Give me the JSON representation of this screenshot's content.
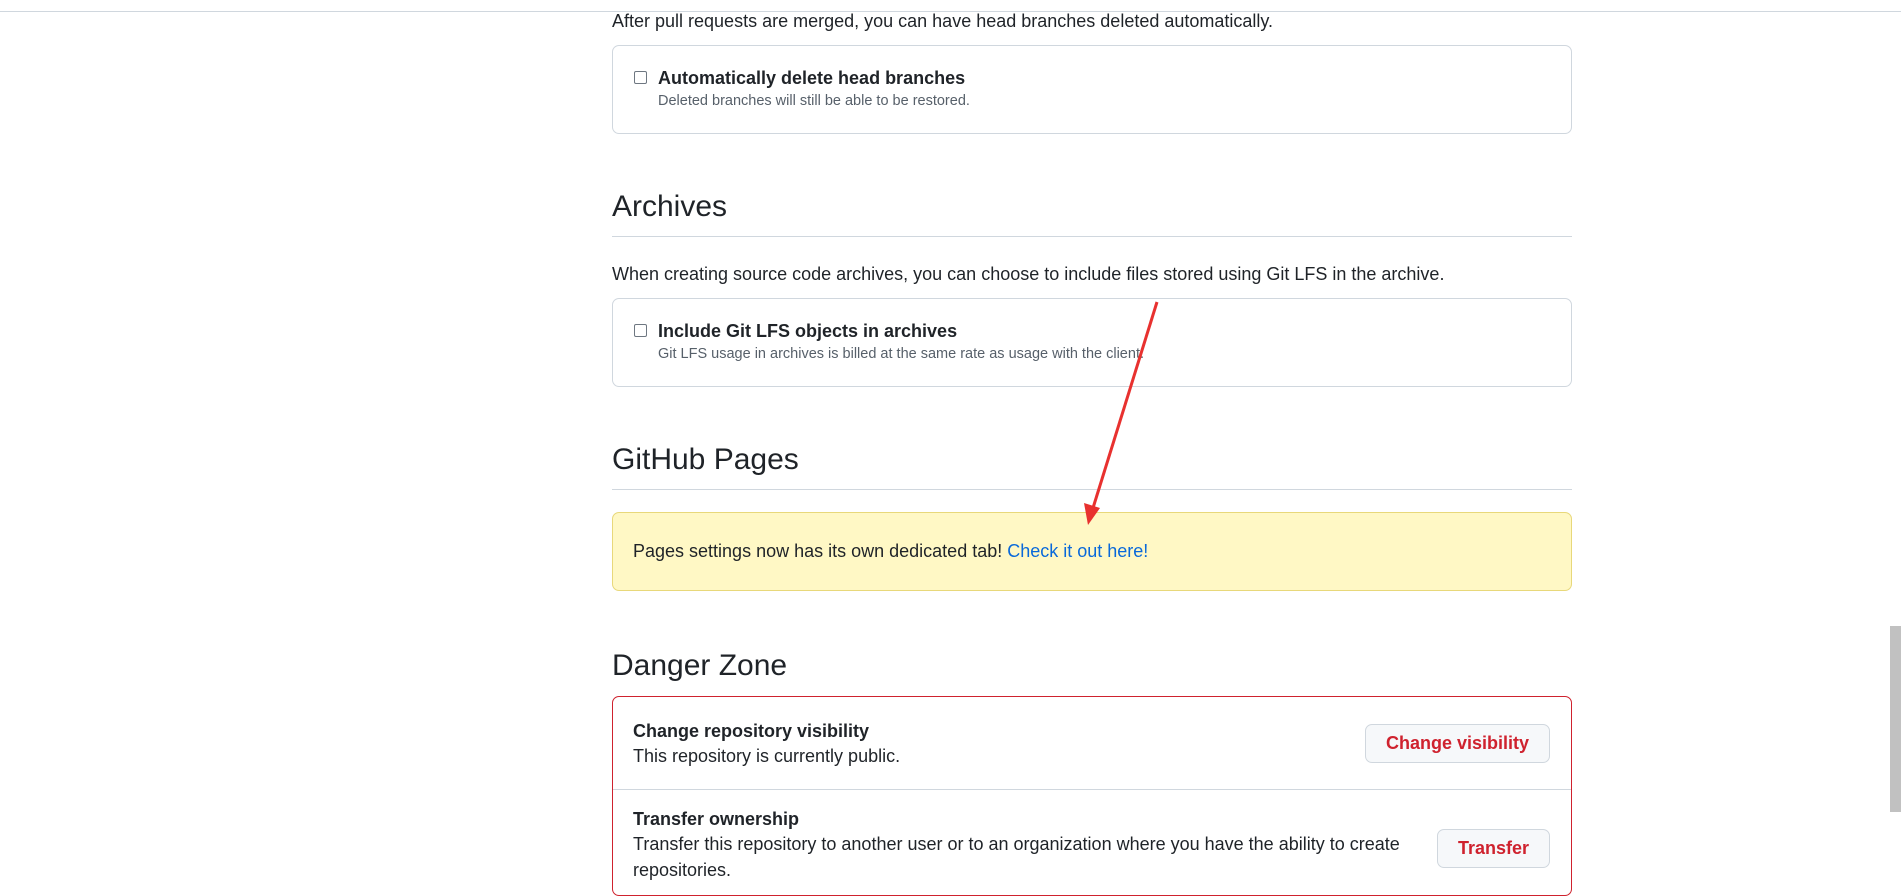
{
  "merge": {
    "description": "After pull requests are merged, you can have head branches deleted automatically.",
    "option_title": "Automatically delete head branches",
    "option_note": "Deleted branches will still be able to be restored."
  },
  "archives": {
    "heading": "Archives",
    "description": "When creating source code archives, you can choose to include files stored using Git LFS in the archive.",
    "option_title": "Include Git LFS objects in archives",
    "option_note": "Git LFS usage in archives is billed at the same rate as usage with the client."
  },
  "pages": {
    "heading": "GitHub Pages",
    "flash_text": "Pages settings now has its own dedicated tab!",
    "flash_link": "Check it out here!"
  },
  "danger": {
    "heading": "Danger Zone",
    "items": [
      {
        "title": "Change repository visibility",
        "text": "This repository is currently public.",
        "button": "Change visibility"
      },
      {
        "title": "Transfer ownership",
        "text": "Transfer this repository to another user or to an organization where you have the ability to create repositories.",
        "button": "Transfer"
      }
    ]
  },
  "colors": {
    "danger": "#cf222e",
    "link": "#0969da",
    "flash_bg": "#fff8c5",
    "annotation_arrow": "#e8312f"
  }
}
